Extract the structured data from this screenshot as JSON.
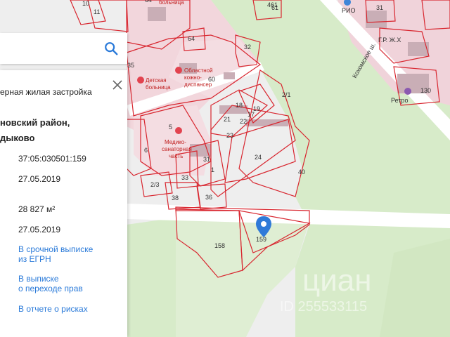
{
  "map": {
    "street_label": "Кохомское ш.",
    "hospital_label_line1": "Детская",
    "hospital_label_line2": "больница",
    "dispensary_line1": "Областной",
    "dispensary_line2": "кожно-",
    "dispensary_line3": "диспансер",
    "sanatorium_line1": "Медико-",
    "sanatorium_line2": "санаторная",
    "sanatorium_line3": "часть",
    "top_hospital_label": "больница",
    "rio_label": "РИО",
    "retro_label": "Ретро",
    "small_shop_label": "Г.Р. Ж.Х",
    "watermark_brand": "циан",
    "watermark_id": "ID 255533115",
    "parcel_numbers": [
      "64",
      "10",
      "11",
      "61",
      "461",
      "31",
      "32",
      "35",
      "64",
      "60",
      "18",
      "19",
      "21",
      "22",
      "17",
      "23",
      "5",
      "6",
      "24",
      "31",
      "1",
      "2/1",
      "40",
      "2/3",
      "38",
      "36",
      "33",
      "158",
      "159",
      "130"
    ],
    "parcel_color": "#d8262f",
    "road_color": "#ffffff",
    "green_color": "#d7ebc9"
  },
  "search": {
    "placeholder": ""
  },
  "panel": {
    "category_text": "ерная жилая застройка",
    "district_line1": "новский район,",
    "district_line2": "дыково",
    "cadastral_number": "37:05:030501:159",
    "cadastral_date": "27.05.2019",
    "area": "28 827 м²",
    "area_date": "27.05.2019",
    "link_egrn_line1": "В срочной выписке",
    "link_egrn_line2": "из ЕГРН",
    "link_transfer_line1": "В выписке",
    "link_transfer_line2": "о переходе прав",
    "link_risks": "В отчете о рисках"
  }
}
